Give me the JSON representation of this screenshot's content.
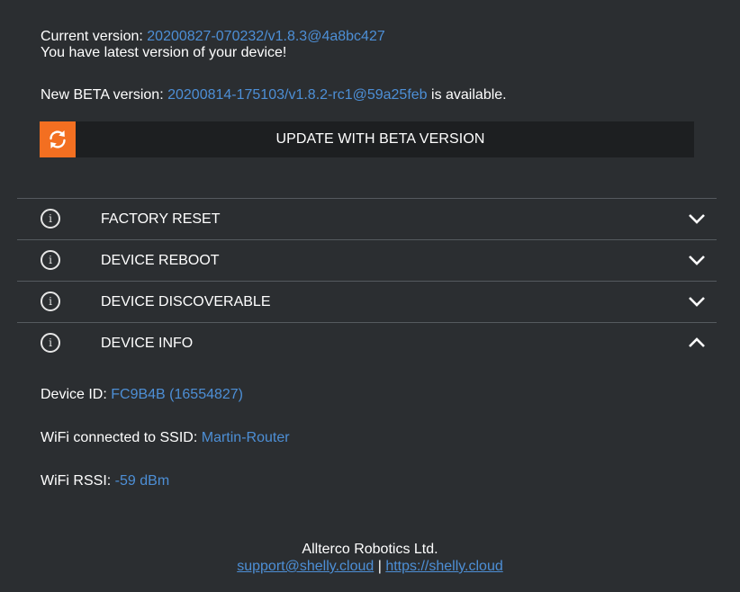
{
  "firmware": {
    "current_label": "Current version: ",
    "current_version": "20200827-070232/v1.8.3@4a8bc427",
    "status": "You have latest version of your device!",
    "beta_prefix": "New BETA version: ",
    "beta_version": "20200814-175103/v1.8.2-rc1@59a25feb",
    "beta_suffix": " is available.",
    "update_button": "UPDATE WITH BETA VERSION",
    "update_icon": "refresh-icon"
  },
  "sections": [
    {
      "label": "FACTORY RESET",
      "expanded": false,
      "icon": "info-icon"
    },
    {
      "label": "DEVICE REBOOT",
      "expanded": false,
      "icon": "info-icon"
    },
    {
      "label": "DEVICE DISCOVERABLE",
      "expanded": false,
      "icon": "info-icon"
    },
    {
      "label": "DEVICE INFO",
      "expanded": true,
      "icon": "info-icon"
    }
  ],
  "device_info": {
    "id_label": "Device ID: ",
    "id_value": "FC9B4B (16554827)",
    "ssid_label": "WiFi connected to SSID: ",
    "ssid_value": "Martin-Router",
    "rssi_label": "WiFi RSSI: ",
    "rssi_value": "-59 dBm"
  },
  "footer": {
    "company": "Allterco Robotics Ltd.",
    "support_link": "support@shelly.cloud",
    "separator": " | ",
    "site_link": "https://shelly.cloud"
  },
  "colors": {
    "background": "#2b2e31",
    "accent": "#f36f21",
    "link": "#4d8fd6"
  }
}
